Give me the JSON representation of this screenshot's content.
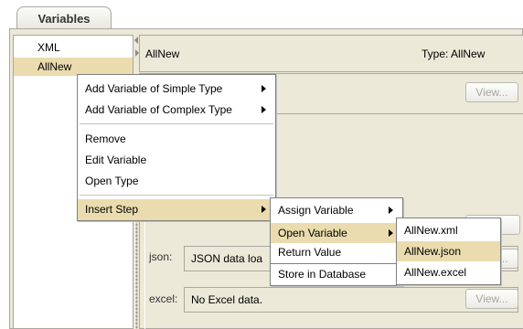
{
  "tab": {
    "label": "Variables"
  },
  "tree": {
    "items": [
      "XML",
      "AllNew"
    ]
  },
  "detail": {
    "name": "AllNew",
    "type": "Type: AllNew",
    "view_label": "View...",
    "view_partial": "v...",
    "fields": {
      "json_label": "json:",
      "json_value": "JSON data loa",
      "excel_label": "excel:",
      "excel_value": "No Excel data."
    }
  },
  "context_menu": {
    "items": [
      "Add Variable of Simple Type",
      "Add Variable of Complex Type",
      "Remove",
      "Edit Variable",
      "Open Type",
      "Insert Step"
    ]
  },
  "insert_step_menu": {
    "items": [
      "Assign Variable",
      "Open Variable",
      "Return Value",
      "Store in Database"
    ]
  },
  "open_variable_menu": {
    "items": [
      "AllNew.xml",
      "AllNew.json",
      "AllNew.excel"
    ]
  },
  "colors": {
    "panel_bg": "#ece9d8",
    "highlight": "#eadcae",
    "border": "#a9a79f"
  }
}
